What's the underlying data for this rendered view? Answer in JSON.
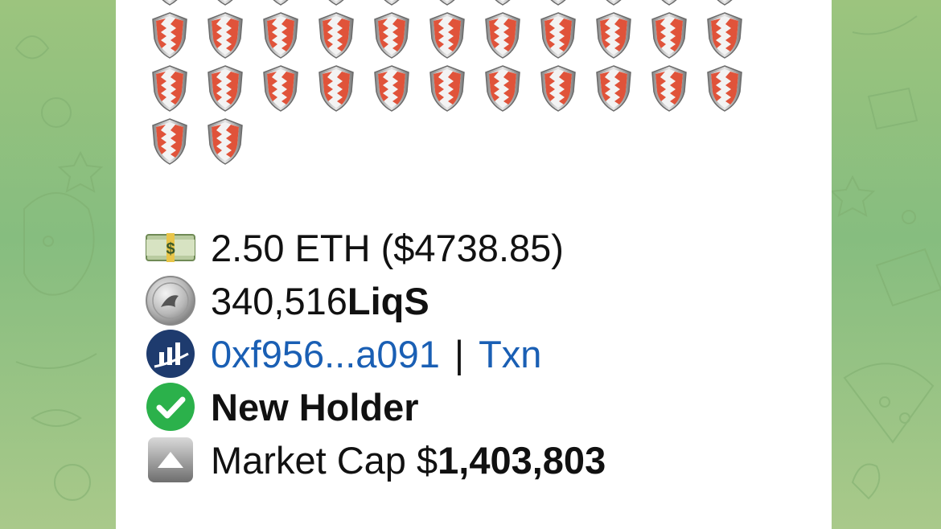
{
  "message": {
    "shield_rows": [
      {
        "count": 11
      },
      {
        "count": 11
      },
      {
        "count": 11
      },
      {
        "count": 2
      }
    ],
    "shield_icon": "bahrain-flag-shield-icon",
    "eth": {
      "icon": "money-bag-dollar-icon",
      "text": "2.50 ETH ($4738.85)"
    },
    "tokens": {
      "icon": "silver-coin-icon",
      "amount": "340,516 ",
      "symbol": "LiqS"
    },
    "wallet": {
      "icon": "chart-logo-icon",
      "address": "0xf956...a091",
      "separator": "|",
      "txn_label": "Txn"
    },
    "holder": {
      "icon": "green-check-icon",
      "text": "New Holder"
    },
    "market_cap": {
      "icon": "up-arrow-box-icon",
      "label": "Market Cap $",
      "value": "1,403,803"
    }
  },
  "colors": {
    "link": "#1a5fb4",
    "check_green": "#2bb14b",
    "shield_red": "#e0533a"
  }
}
